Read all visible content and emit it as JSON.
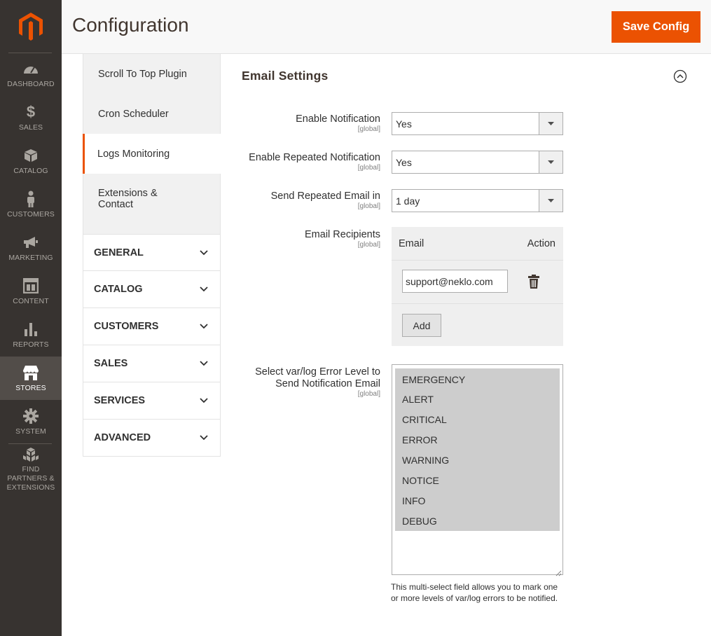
{
  "nav": {
    "items": [
      {
        "label": "DASHBOARD",
        "icon": "dashboard-icon"
      },
      {
        "label": "SALES",
        "icon": "dollar-icon"
      },
      {
        "label": "CATALOG",
        "icon": "box-icon"
      },
      {
        "label": "CUSTOMERS",
        "icon": "person-icon"
      },
      {
        "label": "MARKETING",
        "icon": "megaphone-icon"
      },
      {
        "label": "CONTENT",
        "icon": "layout-icon"
      },
      {
        "label": "REPORTS",
        "icon": "bar-chart-icon"
      },
      {
        "label": "STORES",
        "icon": "store-icon"
      },
      {
        "label": "SYSTEM",
        "icon": "gear-icon"
      },
      {
        "label": "FIND PARTNERS & EXTENSIONS",
        "icon": "cubes-icon"
      }
    ],
    "active": "STORES"
  },
  "header": {
    "title": "Configuration",
    "save_label": "Save Config"
  },
  "tabs": {
    "sub_items": [
      "Scroll To Top Plugin",
      "Cron Scheduler",
      "Logs Monitoring",
      "Extensions & Contact"
    ],
    "active": "Logs Monitoring",
    "groups": [
      "GENERAL",
      "CATALOG",
      "CUSTOMERS",
      "SALES",
      "SERVICES",
      "ADVANCED"
    ]
  },
  "section": {
    "title": "Email Settings"
  },
  "fields": {
    "scope": "[global]",
    "enable_notification": {
      "label": "Enable Notification",
      "value": "Yes"
    },
    "enable_repeated": {
      "label": "Enable Repeated Notification",
      "value": "Yes"
    },
    "send_repeated": {
      "label": "Send Repeated Email in",
      "value": "1 day"
    },
    "recipients": {
      "label": "Email Recipients",
      "col_email": "Email",
      "col_action": "Action",
      "rows": [
        {
          "email": "support@neklo.com"
        }
      ],
      "add_label": "Add"
    },
    "error_level": {
      "label_line1": "Select var/log Error Level to",
      "label_line2": "Send Notification Email",
      "options": [
        "EMERGENCY",
        "ALERT",
        "CRITICAL",
        "ERROR",
        "WARNING",
        "NOTICE",
        "INFO",
        "DEBUG"
      ],
      "note": "This multi-select field allows you to mark one or more levels of var/log errors to be notified."
    }
  },
  "colors": {
    "accent": "#eb5202",
    "nav_bg": "#373330"
  }
}
